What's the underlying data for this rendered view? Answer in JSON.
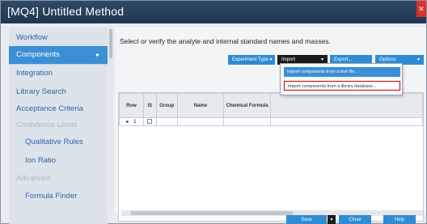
{
  "window": {
    "title": "[MQ4] Untitled Method"
  },
  "sidebar": {
    "items": [
      {
        "label": "Workflow"
      },
      {
        "label": "Components",
        "arrow": "▸"
      },
      {
        "label": "Integration"
      },
      {
        "label": "Library Search"
      },
      {
        "label": "Acceptance Criteria"
      },
      {
        "label": "Confidence Limits"
      },
      {
        "label": "Qualitative Rules"
      },
      {
        "label": "Ion Ratio"
      },
      {
        "label": "Advanced"
      },
      {
        "label": "Formula Finder"
      }
    ]
  },
  "main": {
    "instruction": "Select or verify the analyte and internal standard names and masses.",
    "toolbar": {
      "experiment_type": "Experiment Type ▾",
      "import": "Import",
      "import_arrow": "▾",
      "export": "Export...",
      "options": "Options",
      "options_arrow": "▾"
    },
    "grid": {
      "columns": [
        "Row",
        "IS",
        "Group",
        "Name",
        "Chemical Formula"
      ],
      "rows": [
        {
          "indicator": "▸",
          "row": "1"
        }
      ]
    },
    "import_menu": {
      "items": [
        "Import components from a text file...",
        "Import components from a library database..."
      ]
    }
  },
  "footer": {
    "save": "Save",
    "close": "Close",
    "help": "Help"
  }
}
